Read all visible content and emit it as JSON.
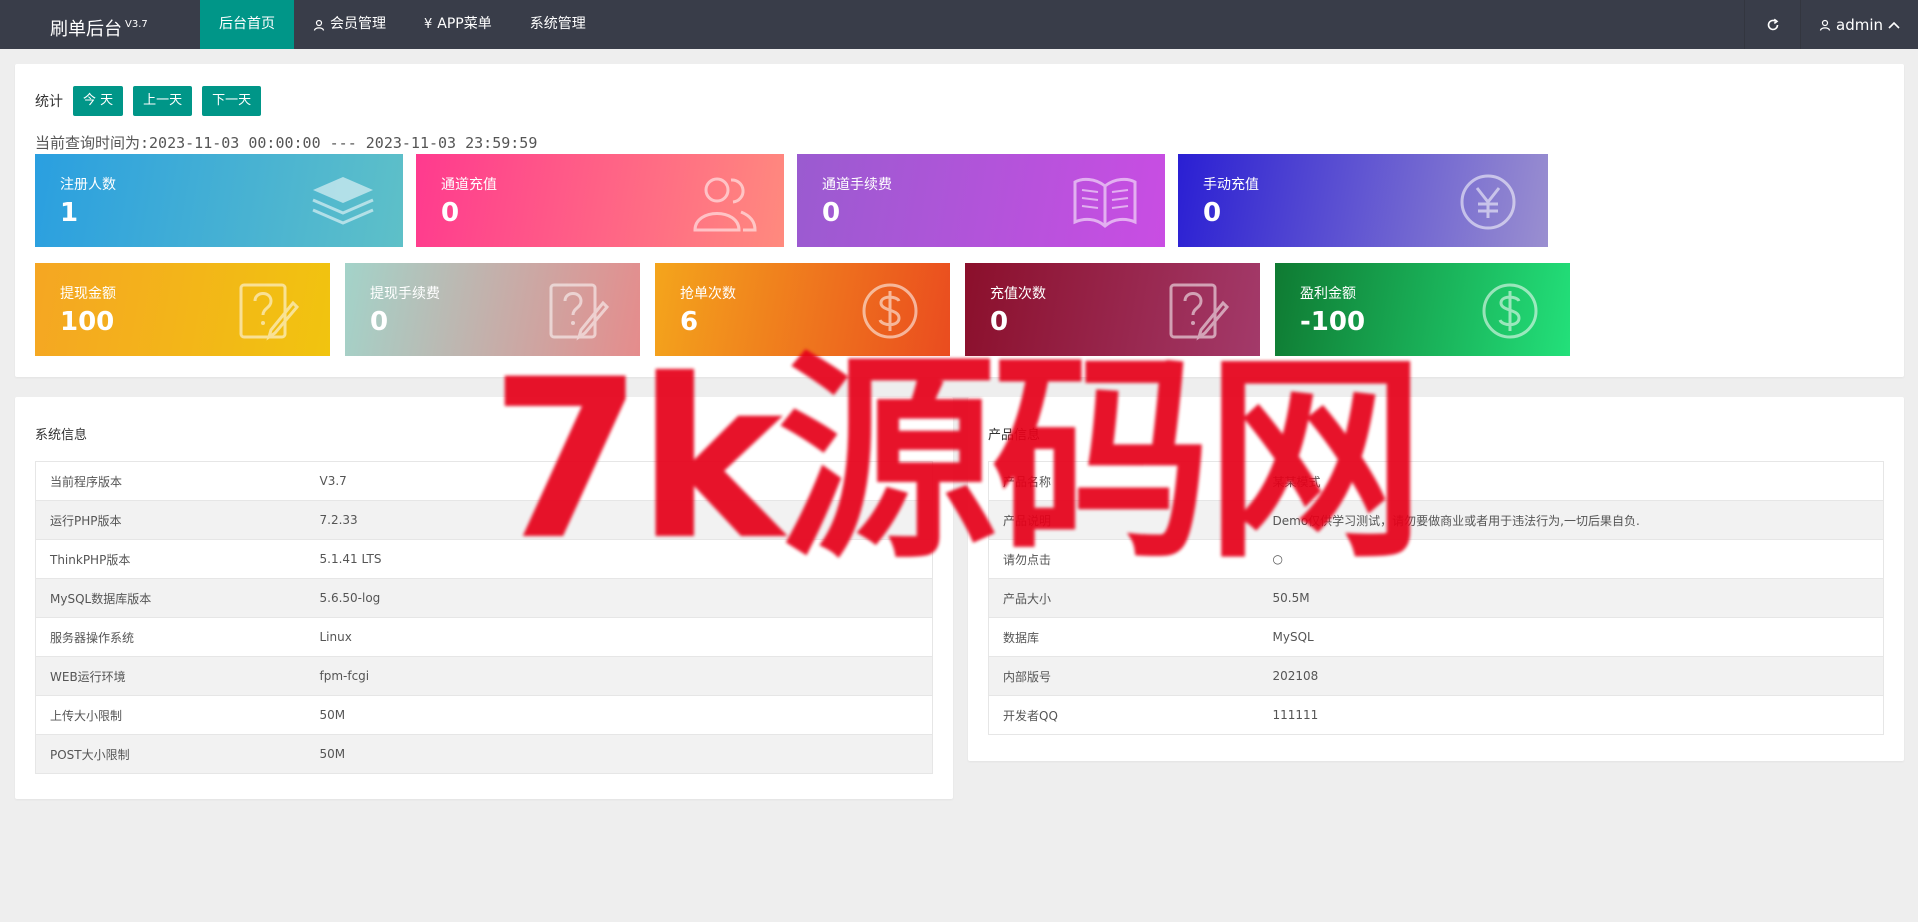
{
  "header": {
    "logo": "刷单后台",
    "version": "V3.7",
    "nav": [
      {
        "label": "后台首页",
        "icon": "",
        "active": true
      },
      {
        "label": "会员管理",
        "icon": "user-icon"
      },
      {
        "label": "APP菜单",
        "icon": "yen-icon"
      },
      {
        "label": "系统管理",
        "icon": ""
      }
    ],
    "user": "admin"
  },
  "stats": {
    "label": "统计",
    "buttons": {
      "today": "今 天",
      "prev": "上一天",
      "next": "下一天"
    },
    "query_time": "当前查询时间为:2023-11-03 00:00:00 --- 2023-11-03 23:59:59",
    "cards": [
      {
        "title": "注册人数",
        "value": "1",
        "icon": "layers-icon",
        "colors": [
          "#2a9fe0",
          "#5ec0c8"
        ]
      },
      {
        "title": "通道充值",
        "value": "0",
        "icon": "users-icon",
        "colors": [
          "#ff3a8e",
          "#ff8a7e"
        ]
      },
      {
        "title": "通道手续费",
        "value": "0",
        "icon": "book-icon",
        "colors": [
          "#9a5bd0",
          "#c94de3"
        ]
      },
      {
        "title": "手动充值",
        "value": "0",
        "icon": "yen-circle-icon",
        "colors": [
          "#2a1fd3",
          "#9a8fd0"
        ]
      },
      {
        "title": "提现金额",
        "value": "100",
        "icon": "edit-question-icon",
        "colors": [
          "#f5a623",
          "#f1c40f"
        ]
      },
      {
        "title": "提现手续费",
        "value": "0",
        "icon": "edit-question-icon",
        "colors": [
          "#a3d3c9",
          "#e58c8c"
        ]
      },
      {
        "title": "抢单次数",
        "value": "6",
        "icon": "dollar-circle-icon",
        "colors": [
          "#f4a51c",
          "#ea4c1f"
        ]
      },
      {
        "title": "充值次数",
        "value": "0",
        "icon": "edit-question-icon",
        "colors": [
          "#8b0f2b",
          "#a33a6a"
        ]
      },
      {
        "title": "盈利金额",
        "value": "-100",
        "icon": "dollar-circle-icon",
        "colors": [
          "#0f7a32",
          "#23e07a"
        ]
      }
    ]
  },
  "system_info": {
    "title": "系统信息",
    "rows": [
      [
        "当前程序版本",
        "V3.7"
      ],
      [
        "运行PHP版本",
        "7.2.33"
      ],
      [
        "ThinkPHP版本",
        "5.1.41 LTS"
      ],
      [
        "MySQL数据库版本",
        "5.6.50-log"
      ],
      [
        "服务器操作系统",
        "Linux"
      ],
      [
        "WEB运行环境",
        "fpm-fcgi"
      ],
      [
        "上传大小限制",
        "50M"
      ],
      [
        "POST大小限制",
        "50M"
      ]
    ]
  },
  "product_info": {
    "title": "产品信息",
    "rows": [
      [
        "产品名称",
        "某某模式"
      ],
      [
        "产品说明",
        "Demo仅供学习测试，请勿要做商业或者用于违法行为,一切后果自负."
      ],
      [
        "请勿点击",
        "○"
      ],
      [
        "产品大小",
        "50.5M"
      ],
      [
        "数据库",
        "MySQL"
      ],
      [
        "内部版号",
        "202108"
      ],
      [
        "开发者QQ",
        "111111"
      ]
    ]
  },
  "watermark": "7k源码网"
}
